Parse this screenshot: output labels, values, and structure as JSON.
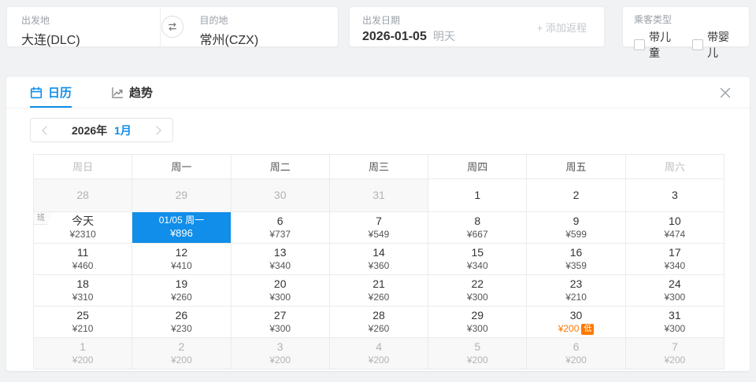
{
  "colors": {
    "accent": "#108ee9",
    "low_price": "#ff7800"
  },
  "search_bar": {
    "origin": {
      "label": "出发地",
      "value": "大连(DLC)"
    },
    "destination": {
      "label": "目的地",
      "value": "常州(CZX)"
    },
    "swap_icon": "swap-horizontal-icon",
    "date": {
      "label": "出发日期",
      "value": "2026-01-05",
      "hint": "明天"
    },
    "add_return_label": "+ 添加返程",
    "passenger": {
      "label": "乘客类型",
      "options": [
        {
          "label": "带儿童",
          "checked": false
        },
        {
          "label": "带婴儿",
          "checked": false
        }
      ]
    }
  },
  "panel": {
    "tabs": [
      {
        "label": "日历",
        "icon": "calendar-icon",
        "active": true
      },
      {
        "label": "趋势",
        "icon": "trend-icon",
        "active": false
      }
    ],
    "close_icon": "close-x-icon",
    "month_nav": {
      "year": "2026年",
      "month": "1月"
    },
    "calendar": {
      "weekday_headers": [
        "周日",
        "周一",
        "周二",
        "周三",
        "周四",
        "周五",
        "周六"
      ],
      "weekend_indices": [
        0,
        6
      ],
      "weeks": [
        [
          {
            "day": "28",
            "muted": true
          },
          {
            "day": "29",
            "muted": true
          },
          {
            "day": "30",
            "muted": true
          },
          {
            "day": "31",
            "muted": true
          },
          {
            "day": "1"
          },
          {
            "day": "2"
          },
          {
            "day": "3"
          }
        ],
        [
          {
            "day": "今天",
            "price": "¥2310",
            "tag": "班"
          },
          {
            "day": "01/05 周一",
            "price": "¥896",
            "selected": true
          },
          {
            "day": "6",
            "price": "¥737"
          },
          {
            "day": "7",
            "price": "¥549"
          },
          {
            "day": "8",
            "price": "¥667"
          },
          {
            "day": "9",
            "price": "¥599"
          },
          {
            "day": "10",
            "price": "¥474"
          }
        ],
        [
          {
            "day": "11",
            "price": "¥460"
          },
          {
            "day": "12",
            "price": "¥410"
          },
          {
            "day": "13",
            "price": "¥340"
          },
          {
            "day": "14",
            "price": "¥360"
          },
          {
            "day": "15",
            "price": "¥340"
          },
          {
            "day": "16",
            "price": "¥359"
          },
          {
            "day": "17",
            "price": "¥340"
          }
        ],
        [
          {
            "day": "18",
            "price": "¥310"
          },
          {
            "day": "19",
            "price": "¥260"
          },
          {
            "day": "20",
            "price": "¥300"
          },
          {
            "day": "21",
            "price": "¥260"
          },
          {
            "day": "22",
            "price": "¥300"
          },
          {
            "day": "23",
            "price": "¥210"
          },
          {
            "day": "24",
            "price": "¥300"
          }
        ],
        [
          {
            "day": "25",
            "price": "¥210"
          },
          {
            "day": "26",
            "price": "¥230"
          },
          {
            "day": "27",
            "price": "¥300"
          },
          {
            "day": "28",
            "price": "¥260"
          },
          {
            "day": "29",
            "price": "¥300"
          },
          {
            "day": "30",
            "price": "¥200",
            "low_badge": "低",
            "highlight": true
          },
          {
            "day": "31",
            "price": "¥300"
          }
        ],
        [
          {
            "day": "1",
            "price": "¥200",
            "muted": true
          },
          {
            "day": "2",
            "price": "¥200",
            "muted": true
          },
          {
            "day": "3",
            "price": "¥200",
            "muted": true
          },
          {
            "day": "4",
            "price": "¥200",
            "muted": true
          },
          {
            "day": "5",
            "price": "¥200",
            "muted": true
          },
          {
            "day": "6",
            "price": "¥200",
            "muted": true
          },
          {
            "day": "7",
            "price": "¥200",
            "muted": true
          }
        ]
      ]
    }
  }
}
